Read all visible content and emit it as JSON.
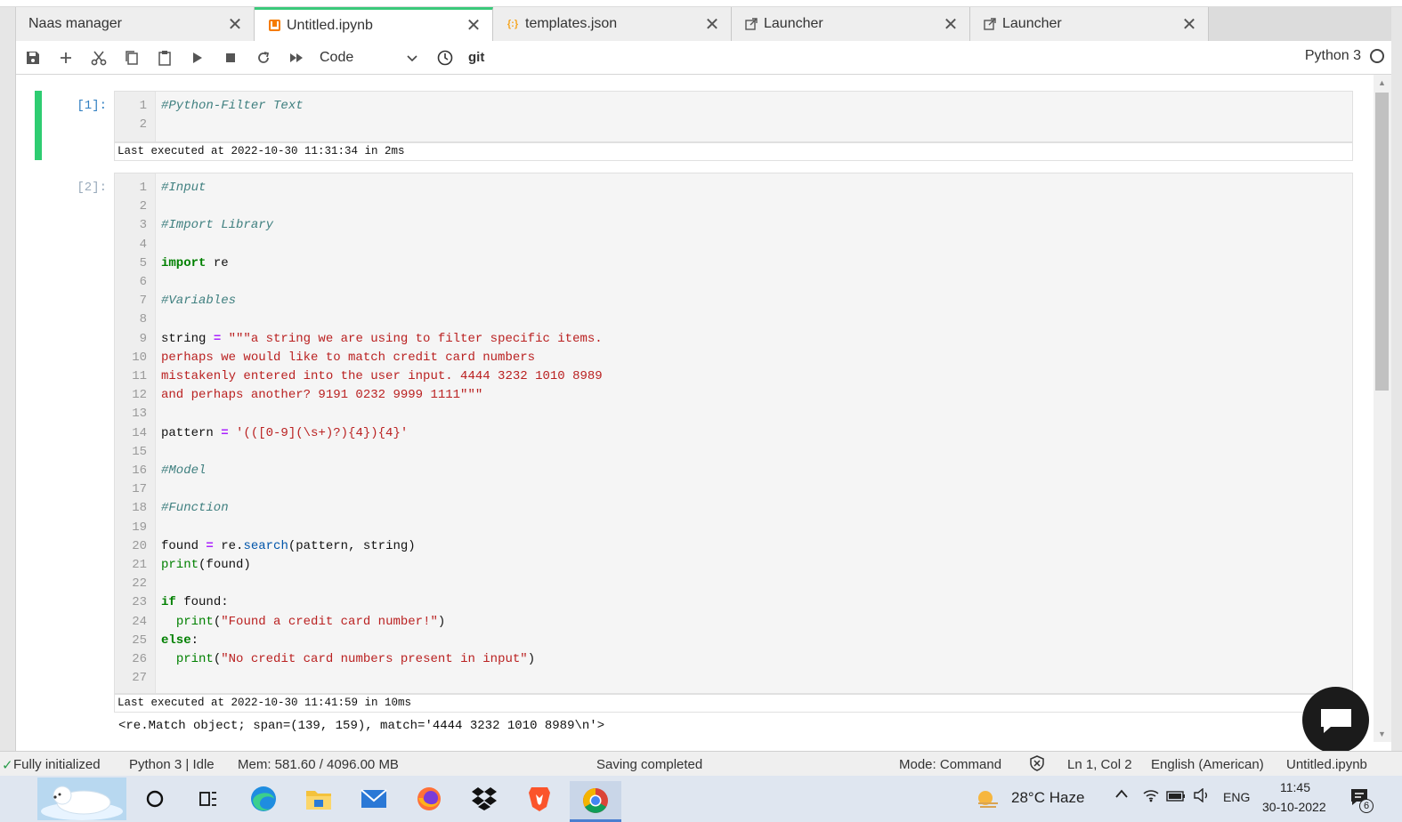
{
  "tabs": [
    {
      "label": "Naas manager",
      "icon": "none"
    },
    {
      "label": "Untitled.ipynb",
      "icon": "notebook-icon"
    },
    {
      "label": "templates.json",
      "icon": "json-icon",
      "icon_text": "{:}"
    },
    {
      "label": "Launcher",
      "icon": "launch-icon"
    },
    {
      "label": "Launcher",
      "icon": "launch-icon"
    }
  ],
  "tab_close": "✕",
  "toolbar": {
    "cell_type": "Code",
    "git_label": "git",
    "kernel_name": "Python 3"
  },
  "cells": [
    {
      "prompt": "[1]:",
      "lines": [
        {
          "n": "1",
          "parts": [
            {
              "t": "#Python-Filter Text",
              "c": "com"
            }
          ]
        },
        {
          "n": "2",
          "parts": []
        }
      ],
      "exec_info": "Last executed at 2022-10-30 11:31:34 in 2ms"
    },
    {
      "prompt": "[2]:",
      "lines": [
        {
          "n": "1",
          "parts": [
            {
              "t": "#Input",
              "c": "com"
            }
          ]
        },
        {
          "n": "2",
          "parts": []
        },
        {
          "n": "3",
          "parts": [
            {
              "t": "#Import Library",
              "c": "com"
            }
          ]
        },
        {
          "n": "4",
          "parts": []
        },
        {
          "n": "5",
          "parts": [
            {
              "t": "import",
              "c": "kw"
            },
            {
              "t": " re",
              "c": ""
            }
          ]
        },
        {
          "n": "6",
          "parts": []
        },
        {
          "n": "7",
          "parts": [
            {
              "t": "#Variables",
              "c": "com"
            }
          ]
        },
        {
          "n": "8",
          "parts": []
        },
        {
          "n": "9",
          "parts": [
            {
              "t": "string ",
              "c": ""
            },
            {
              "t": "=",
              "c": "op"
            },
            {
              "t": " \"\"\"a string we are using to filter specific items.",
              "c": "str"
            }
          ]
        },
        {
          "n": "10",
          "parts": [
            {
              "t": "perhaps we would like to match credit card numbers",
              "c": "str"
            }
          ]
        },
        {
          "n": "11",
          "parts": [
            {
              "t": "mistakenly entered into the user input. 4444 3232 1010 8989",
              "c": "str"
            }
          ]
        },
        {
          "n": "12",
          "parts": [
            {
              "t": "and perhaps another? 9191 0232 9999 1111\"\"\"",
              "c": "str"
            }
          ]
        },
        {
          "n": "13",
          "parts": []
        },
        {
          "n": "14",
          "parts": [
            {
              "t": "pattern ",
              "c": ""
            },
            {
              "t": "=",
              "c": "op"
            },
            {
              "t": " '(([0-9](\\s+)?){4}){4}'",
              "c": "str"
            }
          ]
        },
        {
          "n": "15",
          "parts": []
        },
        {
          "n": "16",
          "parts": [
            {
              "t": "#Model",
              "c": "com"
            }
          ]
        },
        {
          "n": "17",
          "parts": []
        },
        {
          "n": "18",
          "parts": [
            {
              "t": "#Function",
              "c": "com"
            }
          ]
        },
        {
          "n": "19",
          "parts": []
        },
        {
          "n": "20",
          "parts": [
            {
              "t": "found ",
              "c": ""
            },
            {
              "t": "=",
              "c": "op"
            },
            {
              "t": " re.",
              "c": ""
            },
            {
              "t": "search",
              "c": "fn"
            },
            {
              "t": "(pattern, string)",
              "c": ""
            }
          ]
        },
        {
          "n": "21",
          "parts": [
            {
              "t": "print",
              "c": "bi"
            },
            {
              "t": "(found)",
              "c": ""
            }
          ]
        },
        {
          "n": "22",
          "parts": []
        },
        {
          "n": "23",
          "parts": [
            {
              "t": "if",
              "c": "kw"
            },
            {
              "t": " found:",
              "c": ""
            }
          ]
        },
        {
          "n": "24",
          "parts": [
            {
              "t": "  ",
              "c": ""
            },
            {
              "t": "print",
              "c": "bi"
            },
            {
              "t": "(",
              "c": ""
            },
            {
              "t": "\"Found a credit card number!\"",
              "c": "str"
            },
            {
              "t": ")",
              "c": ""
            }
          ]
        },
        {
          "n": "25",
          "parts": [
            {
              "t": "else",
              "c": "kw"
            },
            {
              "t": ":",
              "c": ""
            }
          ]
        },
        {
          "n": "26",
          "parts": [
            {
              "t": "  ",
              "c": ""
            },
            {
              "t": "print",
              "c": "bi"
            },
            {
              "t": "(",
              "c": ""
            },
            {
              "t": "\"No credit card numbers present in input\"",
              "c": "str"
            },
            {
              "t": ")",
              "c": ""
            }
          ]
        },
        {
          "n": "27",
          "parts": []
        }
      ],
      "exec_info": "Last executed at 2022-10-30 11:41:59 in 10ms",
      "output": "<re.Match object; span=(139, 159), match='4444 3232 1010 8989\\n'>"
    }
  ],
  "statusbar": {
    "init": "Fully initialized",
    "kernel_status": "Python 3 | Idle",
    "memory": "Mem: 581.60 / 4096.00 MB",
    "saving": "Saving completed",
    "mode": "Mode: Command",
    "position": "Ln 1, Col 2",
    "language": "English (American)",
    "filename": "Untitled.ipynb"
  },
  "taskbar": {
    "weather": "28°C  Haze",
    "lang": "ENG",
    "time": "11:45",
    "date": "30-10-2022",
    "notif_count": "6"
  },
  "colors": {
    "active_tab_accent": "#3ac97a",
    "active_cell_bar": "#2ecc71",
    "comment": "#408080",
    "keyword": "#008000",
    "string": "#ba2121",
    "operator": "#aa22ff"
  }
}
